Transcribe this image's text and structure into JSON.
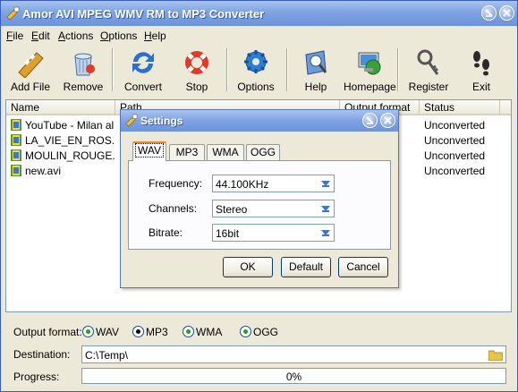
{
  "window": {
    "title": "Amor AVI MPEG WMV RM to MP3 Converter"
  },
  "menu": [
    {
      "pre": "",
      "acc": "F",
      "rest": "ile"
    },
    {
      "pre": "",
      "acc": "E",
      "rest": "dit"
    },
    {
      "pre": "",
      "acc": "A",
      "rest": "ctions"
    },
    {
      "pre": "",
      "acc": "O",
      "rest": "ptions"
    },
    {
      "pre": "",
      "acc": "H",
      "rest": "elp"
    }
  ],
  "toolbar": {
    "add_file": "Add File",
    "remove": "Remove",
    "convert": "Convert",
    "stop": "Stop",
    "options": "Options",
    "help": "Help",
    "homepage": "Homepage",
    "register": "Register",
    "exit": "Exit"
  },
  "list": {
    "columns": [
      "Name",
      "Path",
      "Output format",
      "Status"
    ],
    "rows": [
      {
        "name": "YouTube - Milan al...",
        "status": "Unconverted"
      },
      {
        "name": "LA_VIE_EN_ROS...",
        "status": "Unconverted"
      },
      {
        "name": "MOULIN_ROUGE...",
        "status": "Unconverted"
      },
      {
        "name": "new.avi",
        "status": "Unconverted"
      }
    ]
  },
  "bottom": {
    "output_format_label": "Output format:",
    "formats": [
      "WAV",
      "MP3",
      "WMA",
      "OGG"
    ],
    "selected_format": "MP3",
    "destination_label": "Destination:",
    "destination_value": "C:\\Temp\\",
    "progress_label": "Progress:",
    "progress_text": "0%",
    "progress_value": 0
  },
  "dialog": {
    "title": "Settings",
    "tabs": [
      "WAV",
      "MP3",
      "WMA",
      "OGG"
    ],
    "active_tab": "WAV",
    "frequency_label": "Frequency:",
    "frequency_value": "44.100KHz",
    "channels_label": "Channels:",
    "channels_value": "Stereo",
    "bitrate_label": "Bitrate:",
    "bitrate_value": "16bit",
    "ok": "OK",
    "default": "Default",
    "cancel": "Cancel"
  }
}
